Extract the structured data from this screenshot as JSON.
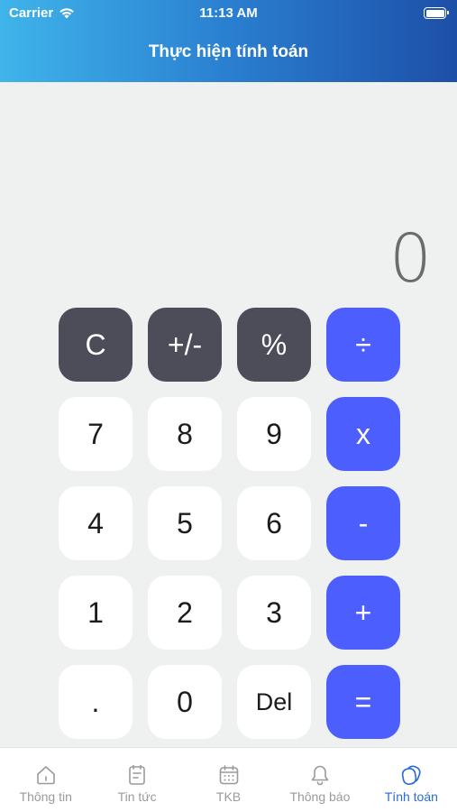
{
  "status_bar": {
    "carrier": "Carrier",
    "time": "11:13 AM"
  },
  "header": {
    "title": "Thực hiện tính toán"
  },
  "display": {
    "value": "0"
  },
  "keypad": {
    "rows": [
      [
        {
          "label": "C",
          "kind": "fn",
          "name": "clear-button"
        },
        {
          "label": "+/-",
          "kind": "fn",
          "name": "sign-toggle-button"
        },
        {
          "label": "%",
          "kind": "fn",
          "name": "percent-button"
        },
        {
          "label": "÷",
          "kind": "op",
          "name": "divide-button"
        }
      ],
      [
        {
          "label": "7",
          "kind": "num",
          "name": "digit-7-button"
        },
        {
          "label": "8",
          "kind": "num",
          "name": "digit-8-button"
        },
        {
          "label": "9",
          "kind": "num",
          "name": "digit-9-button"
        },
        {
          "label": "x",
          "kind": "op",
          "name": "multiply-button"
        }
      ],
      [
        {
          "label": "4",
          "kind": "num",
          "name": "digit-4-button"
        },
        {
          "label": "5",
          "kind": "num",
          "name": "digit-5-button"
        },
        {
          "label": "6",
          "kind": "num",
          "name": "digit-6-button"
        },
        {
          "label": "-",
          "kind": "op",
          "name": "subtract-button"
        }
      ],
      [
        {
          "label": "1",
          "kind": "num",
          "name": "digit-1-button"
        },
        {
          "label": "2",
          "kind": "num",
          "name": "digit-2-button"
        },
        {
          "label": "3",
          "kind": "num",
          "name": "digit-3-button"
        },
        {
          "label": "+",
          "kind": "op",
          "name": "add-button"
        }
      ],
      [
        {
          "label": ".",
          "kind": "num",
          "name": "decimal-button"
        },
        {
          "label": "0",
          "kind": "num",
          "name": "digit-0-button"
        },
        {
          "label": "Del",
          "kind": "del",
          "name": "delete-button"
        },
        {
          "label": "=",
          "kind": "op",
          "name": "equals-button"
        }
      ]
    ]
  },
  "tabbar": {
    "items": [
      {
        "label": "Thông tin",
        "icon": "home-icon",
        "active": false
      },
      {
        "label": "Tin tức",
        "icon": "news-icon",
        "active": false
      },
      {
        "label": "TKB",
        "icon": "calendar-icon",
        "active": false
      },
      {
        "label": "Thông báo",
        "icon": "bell-icon",
        "active": false
      },
      {
        "label": "Tính toán",
        "icon": "calculator-icon",
        "active": true
      }
    ]
  },
  "colors": {
    "header_start": "#3fb4ea",
    "header_end": "#1d4fa8",
    "function_key": "#4c4d59",
    "operator_key": "#4c5efd",
    "active_tab": "#2a6bd6",
    "inactive_tab": "#9a9a9a"
  }
}
